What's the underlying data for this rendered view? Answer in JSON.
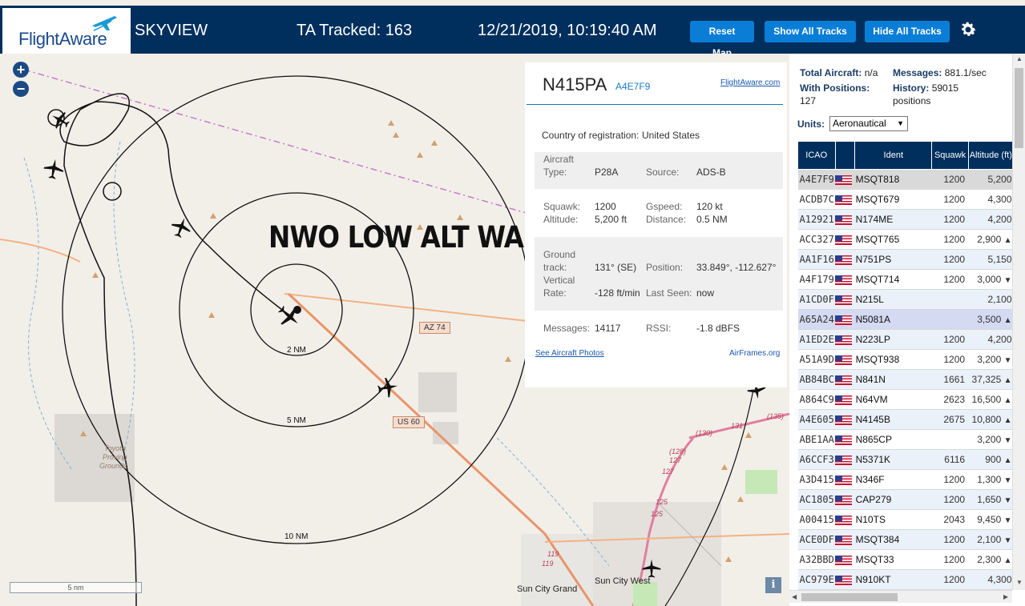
{
  "header": {
    "logo_text": "FlightAware",
    "app_title": "SKYVIEW",
    "tracked": "TA Tracked: 163",
    "datetime": "12/21/2019, 10:19:40 AM",
    "buttons": {
      "reset": "Reset Map",
      "show_all": "Show All Tracks",
      "hide_all": "Hide All Tracks"
    },
    "settings_icon": "gear-icon",
    "colors": {
      "bar": "#002f5d",
      "button": "#0a7ed6"
    }
  },
  "map": {
    "zoom_in": "+",
    "zoom_out": "−",
    "overlay_text": "NWO LOW ALT WARRIOR",
    "ring_labels": [
      "2 NM",
      "5 NM",
      "10 NM"
    ],
    "road_shields": [
      "AZ 74",
      "US 60"
    ],
    "places": [
      "Sun City Grand",
      "Sun City West"
    ],
    "proving_ground": [
      "Toyota",
      "Proving",
      "Grounds"
    ],
    "road_numbers": [
      "(135)",
      "131",
      "(130)",
      "(128)",
      "127",
      "127",
      "125",
      "119",
      "119",
      "125"
    ],
    "scale_label": "5 nm",
    "info_button": "i"
  },
  "popup": {
    "registration": "N415PA",
    "hex": "A4E7F9",
    "flightaware_link": "FlightAware.com",
    "country_label": "Country of registration:",
    "country": "United States",
    "aircraft_type_label_1": "Aircraft",
    "aircraft_type_label_2": "Type:",
    "aircraft_type": "P28A",
    "source_label": "Source:",
    "source": "ADS-B",
    "squawk_label": "Squawk:",
    "squawk": "1200",
    "gspeed_label": "Gspeed:",
    "gspeed": "120 kt",
    "altitude_label": "Altitude:",
    "altitude": "5,200 ft",
    "distance_label": "Distance:",
    "distance": "0.5 NM",
    "track_label_1": "Ground",
    "track_label_2": "track:",
    "track": "131° (SE)",
    "position_label": "Position:",
    "position": "33.849°, -112.627°",
    "vrate_label_1": "Vertical",
    "vrate_label_2": "Rate:",
    "vrate": "-128 ft/min",
    "seen_label": "Last Seen:",
    "seen": "now",
    "messages_label": "Messages:",
    "messages": "14117",
    "rssi_label": "RSSI:",
    "rssi": "-1.8 dBFS",
    "photos_link": "See Aircraft Photos",
    "airframes_link": "AirFrames.org"
  },
  "sidebar": {
    "total_label": "Total Aircraft:",
    "total": "n/a",
    "messages_label": "Messages:",
    "messages": "881.1/sec",
    "positions_label": "With Positions:",
    "positions": "127",
    "history_label": "History:",
    "history": "59015",
    "history_unit": "positions",
    "units_label": "Units:",
    "units_value": "Aeronautical",
    "columns": [
      "ICAO",
      "",
      "Ident",
      "Squawk",
      "Altitude (ft)"
    ],
    "rows": [
      {
        "icao": "A4E7F9",
        "ident": "MSQT818",
        "squawk": "1200",
        "alt": "5,200",
        "trend": ""
      },
      {
        "icao": "ACDB7C",
        "ident": "MSQT679",
        "squawk": "1200",
        "alt": "4,300",
        "trend": ""
      },
      {
        "icao": "A12921",
        "ident": "N174ME",
        "squawk": "1200",
        "alt": "4,200",
        "trend": ""
      },
      {
        "icao": "ACC327",
        "ident": "MSQT765",
        "squawk": "1200",
        "alt": "2,900",
        "trend": "▲"
      },
      {
        "icao": "AA1F16",
        "ident": "N751PS",
        "squawk": "1200",
        "alt": "5,150",
        "trend": ""
      },
      {
        "icao": "A4F179",
        "ident": "MSQT714",
        "squawk": "1200",
        "alt": "3,000",
        "trend": "▼"
      },
      {
        "icao": "A1CD0F",
        "ident": "N215L",
        "squawk": "",
        "alt": "2,100",
        "trend": ""
      },
      {
        "icao": "A65A24",
        "ident": "N5081A",
        "squawk": "",
        "alt": "3,500",
        "trend": "▲"
      },
      {
        "icao": "A1ED2E",
        "ident": "N223LP",
        "squawk": "1200",
        "alt": "4,200",
        "trend": ""
      },
      {
        "icao": "A51A9D",
        "ident": "MSQT938",
        "squawk": "1200",
        "alt": "3,200",
        "trend": "▼"
      },
      {
        "icao": "AB84BC",
        "ident": "N841N",
        "squawk": "1661",
        "alt": "37,325",
        "trend": "▲"
      },
      {
        "icao": "A864C9",
        "ident": "N64VM",
        "squawk": "2623",
        "alt": "16,500",
        "trend": "▲"
      },
      {
        "icao": "A4E605",
        "ident": "N4145B",
        "squawk": "2675",
        "alt": "10,800",
        "trend": "▲"
      },
      {
        "icao": "ABE1AA",
        "ident": "N865CP",
        "squawk": "",
        "alt": "3,200",
        "trend": "▼"
      },
      {
        "icao": "A6CCF3",
        "ident": "N5371K",
        "squawk": "6116",
        "alt": "900",
        "trend": "▲"
      },
      {
        "icao": "A3D415",
        "ident": "N346F",
        "squawk": "1200",
        "alt": "1,300",
        "trend": "▼"
      },
      {
        "icao": "AC1805",
        "ident": "CAP279",
        "squawk": "1200",
        "alt": "1,650",
        "trend": "▼"
      },
      {
        "icao": "A00415",
        "ident": "N10TS",
        "squawk": "2043",
        "alt": "9,450",
        "trend": "▼"
      },
      {
        "icao": "ACE0DF",
        "ident": "MSQT384",
        "squawk": "1200",
        "alt": "2,100",
        "trend": "▼"
      },
      {
        "icao": "A32BBD",
        "ident": "MSQT33",
        "squawk": "1200",
        "alt": "2,300",
        "trend": "▲"
      },
      {
        "icao": "AC979E",
        "ident": "N910KT",
        "squawk": "1200",
        "alt": "4,300",
        "trend": ""
      }
    ]
  }
}
